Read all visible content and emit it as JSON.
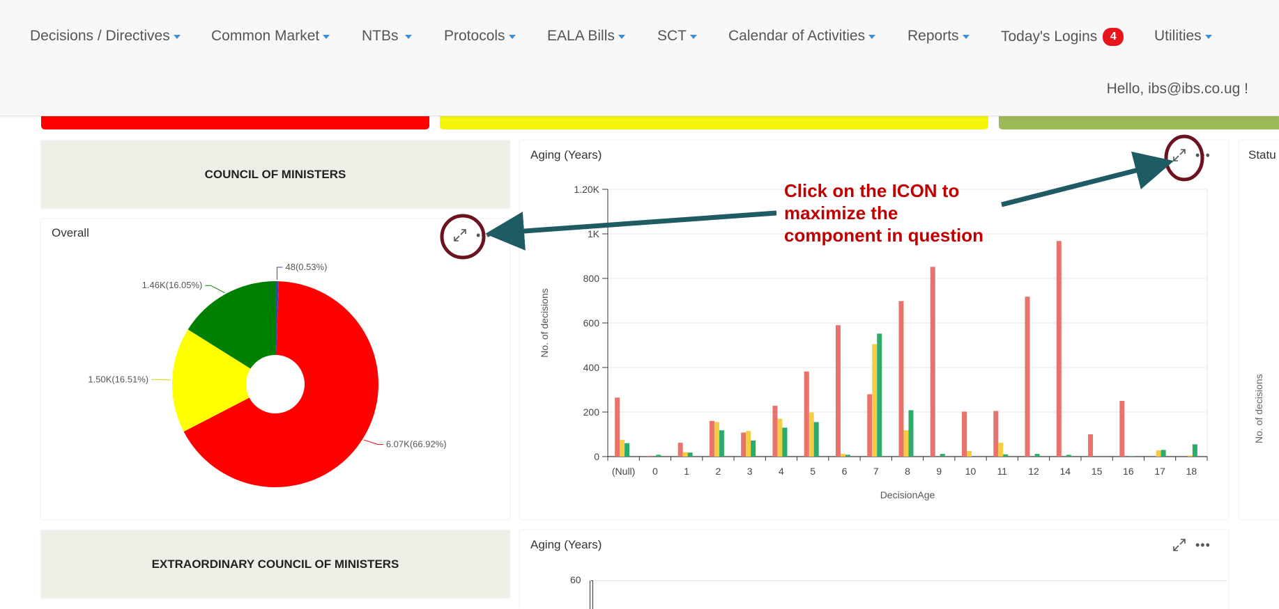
{
  "nav": {
    "items": [
      {
        "label": "Decisions / Directives"
      },
      {
        "label": "Common Market"
      },
      {
        "label": "NTBs"
      },
      {
        "label": "Protocols"
      },
      {
        "label": "EALA Bills"
      },
      {
        "label": "SCT"
      },
      {
        "label": "Calendar of Activities"
      },
      {
        "label": "Reports"
      },
      {
        "label": "Today's Logins",
        "badge": "4"
      },
      {
        "label": "Utilities"
      }
    ],
    "greeting": "Hello, ibs@ibs.co.ug !"
  },
  "colors": {
    "red": "#ff0000",
    "yellow": "#ffff00",
    "green": "#008000",
    "bar_red": "#e8736c",
    "bar_yellow": "#f7cc45",
    "bar_green": "#2dab6b",
    "callout": "#c00000",
    "arrow": "#1e5b63"
  },
  "sections": {
    "council": {
      "title": "COUNCIL OF MINISTERS"
    },
    "extra": {
      "title": "EXTRAORDINARY COUNCIL OF MINISTERS"
    }
  },
  "pie_panel": {
    "title": "Overall",
    "icons": [
      "expand-icon",
      "more-icon"
    ]
  },
  "aging_panel": {
    "title": "Aging (Years)",
    "icons": [
      "expand-icon",
      "more-icon"
    ]
  },
  "aging_panel_2": {
    "title": "Aging (Years)",
    "first_tick": "60"
  },
  "status_panel": {
    "title": "Statu",
    "ylabel": "No. of decisions"
  },
  "callout": {
    "line1": "Click on the ICON to",
    "line2": "maximize the",
    "line3": "component in question"
  },
  "chart_data": [
    {
      "type": "pie",
      "title": "Overall",
      "slices": [
        {
          "label": "6.07K(66.92%)",
          "value": 6070,
          "percent": 66.92,
          "color": "#ff0000"
        },
        {
          "label": "1.50K(16.51%)",
          "value": 1500,
          "percent": 16.51,
          "color": "#ffff00"
        },
        {
          "label": "1.46K(16.05%)",
          "value": 1460,
          "percent": 16.05,
          "color": "#008000"
        },
        {
          "label": "48(0.53%)",
          "value": 48,
          "percent": 0.53,
          "color": "#2f4ea0"
        }
      ]
    },
    {
      "type": "bar",
      "title": "Aging (Years)",
      "xlabel": "DecisionAge",
      "ylabel": "No. of decisions",
      "ylim": [
        0,
        1200
      ],
      "yticks": [
        "0",
        "200",
        "400",
        "600",
        "800",
        "1K",
        "1.20K"
      ],
      "categories": [
        "(Null)",
        "0",
        "1",
        "2",
        "3",
        "4",
        "5",
        "6",
        "7",
        "8",
        "9",
        "10",
        "11",
        "12",
        "14",
        "15",
        "16",
        "17",
        "18"
      ],
      "series": [
        {
          "color": "#e8736c",
          "values": [
            265,
            3,
            62,
            160,
            108,
            228,
            382,
            590,
            280,
            698,
            852,
            202,
            205,
            718,
            968,
            100,
            250,
            0,
            0
          ]
        },
        {
          "color": "#f7cc45",
          "values": [
            75,
            0,
            20,
            155,
            115,
            170,
            198,
            12,
            505,
            118,
            0,
            25,
            62,
            0,
            0,
            0,
            0,
            28,
            5
          ]
        },
        {
          "color": "#2dab6b",
          "values": [
            60,
            8,
            18,
            118,
            72,
            130,
            155,
            8,
            552,
            208,
            12,
            0,
            10,
            12,
            8,
            0,
            2,
            30,
            55
          ]
        }
      ]
    }
  ]
}
